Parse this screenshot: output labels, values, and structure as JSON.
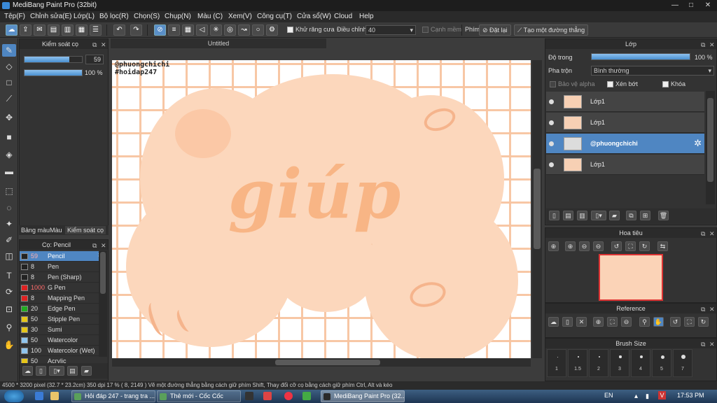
{
  "window": {
    "title": "MediBang Paint Pro (32bit)",
    "min": "—",
    "max": "□",
    "close": "✕"
  },
  "menu": [
    "Tệp(F)",
    "Chỉnh sửa(E)",
    "Lớp(L)",
    "Bộ lọc(R)",
    "Chọn(S)",
    "Chụp(N)",
    "Màu (C)",
    "Xem(V)",
    "Công cụ(T)",
    "Cửa sổ(W)",
    "Cloud",
    "Help"
  ],
  "toolbar": {
    "antialias_label": "Khử răng cưa",
    "adjust_label": "Điều chỉnh",
    "adjust_value": "40",
    "edge_label": "Cạnh mềm",
    "pen_label": "Phím",
    "reset_label": "Đặt lại",
    "straight_label": "Tạo một đường thẳng"
  },
  "brush_control": {
    "title": "Kiểm soát cọ",
    "size_value": "59",
    "opacity_value": "100 %",
    "size_fraction": 0.78,
    "opacity_fraction": 1.0
  },
  "left_tabs": [
    "Bảng màu",
    "Màu",
    "Kiểm soát cọ"
  ],
  "brush_list": {
    "title": "Cọ: Pencil",
    "items": [
      {
        "size": "59",
        "name": "Pencil",
        "color": "#222222",
        "selected": true
      },
      {
        "size": "8",
        "name": "Pen",
        "color": "#222222"
      },
      {
        "size": "8",
        "name": "Pen (Sharp)",
        "color": "#222222"
      },
      {
        "size": "1000",
        "name": "G Pen",
        "color": "#dd2222"
      },
      {
        "size": "8",
        "name": "Mapping Pen",
        "color": "#dd2222"
      },
      {
        "size": "20",
        "name": "Edge Pen",
        "color": "#22aa22"
      },
      {
        "size": "50",
        "name": "Stipple Pen",
        "color": "#e6c619"
      },
      {
        "size": "30",
        "name": "Sumi",
        "color": "#e6c619"
      },
      {
        "size": "50",
        "name": "Watercolor",
        "color": "#8fc5ee"
      },
      {
        "size": "100",
        "name": "Watercolor (Wet)",
        "color": "#8fc5ee"
      },
      {
        "size": "50",
        "name": "Acrylic",
        "color": "#e6c619"
      }
    ]
  },
  "document": {
    "tab": "Untitled",
    "watermark_line1": "@phuongchichi",
    "watermark_line2": "#hoidap247",
    "art_text": "giúp"
  },
  "layer_panel": {
    "title": "Lớp",
    "opacity_label": "Độ trong",
    "opacity_value": "100 %",
    "opacity_fraction": 1.0,
    "blend_label": "Pha trộn",
    "blend_value": "Bình thường",
    "protect_alpha": "Bảo vệ alpha",
    "clipping": "Xén bớt",
    "lock": "Khóa",
    "layers": [
      {
        "name": "Lớp1",
        "selected": false
      },
      {
        "name": "Lớp1",
        "selected": false
      },
      {
        "name": "@phuongchichi",
        "selected": true
      },
      {
        "name": "Lớp1",
        "selected": false
      }
    ]
  },
  "navigator": {
    "title": "Hoa tiêu"
  },
  "reference": {
    "title": "Reference"
  },
  "brush_size": {
    "title": "Brush Size",
    "labels": [
      "1",
      "1.5",
      "2",
      "3",
      "4",
      "5",
      "7"
    ]
  },
  "status": {
    "text": "4500 * 3200 pixel   (32.7 * 23.2cm)   350 dpi   17 %   ( 8, 2149 )   Vẽ một đường thẳng bằng cách giữ phím Shift, Thay đổi cỡ cọ bằng cách giữ phím Ctrl, Alt và kéo"
  },
  "taskbar": {
    "tasks": [
      "Hỏi đáp 247 - trang tra ...",
      "Thẻ mới - Cốc Cốc",
      "MediBang Paint Pro (32..."
    ],
    "lang": "EN",
    "clock": "17:53 PM"
  }
}
